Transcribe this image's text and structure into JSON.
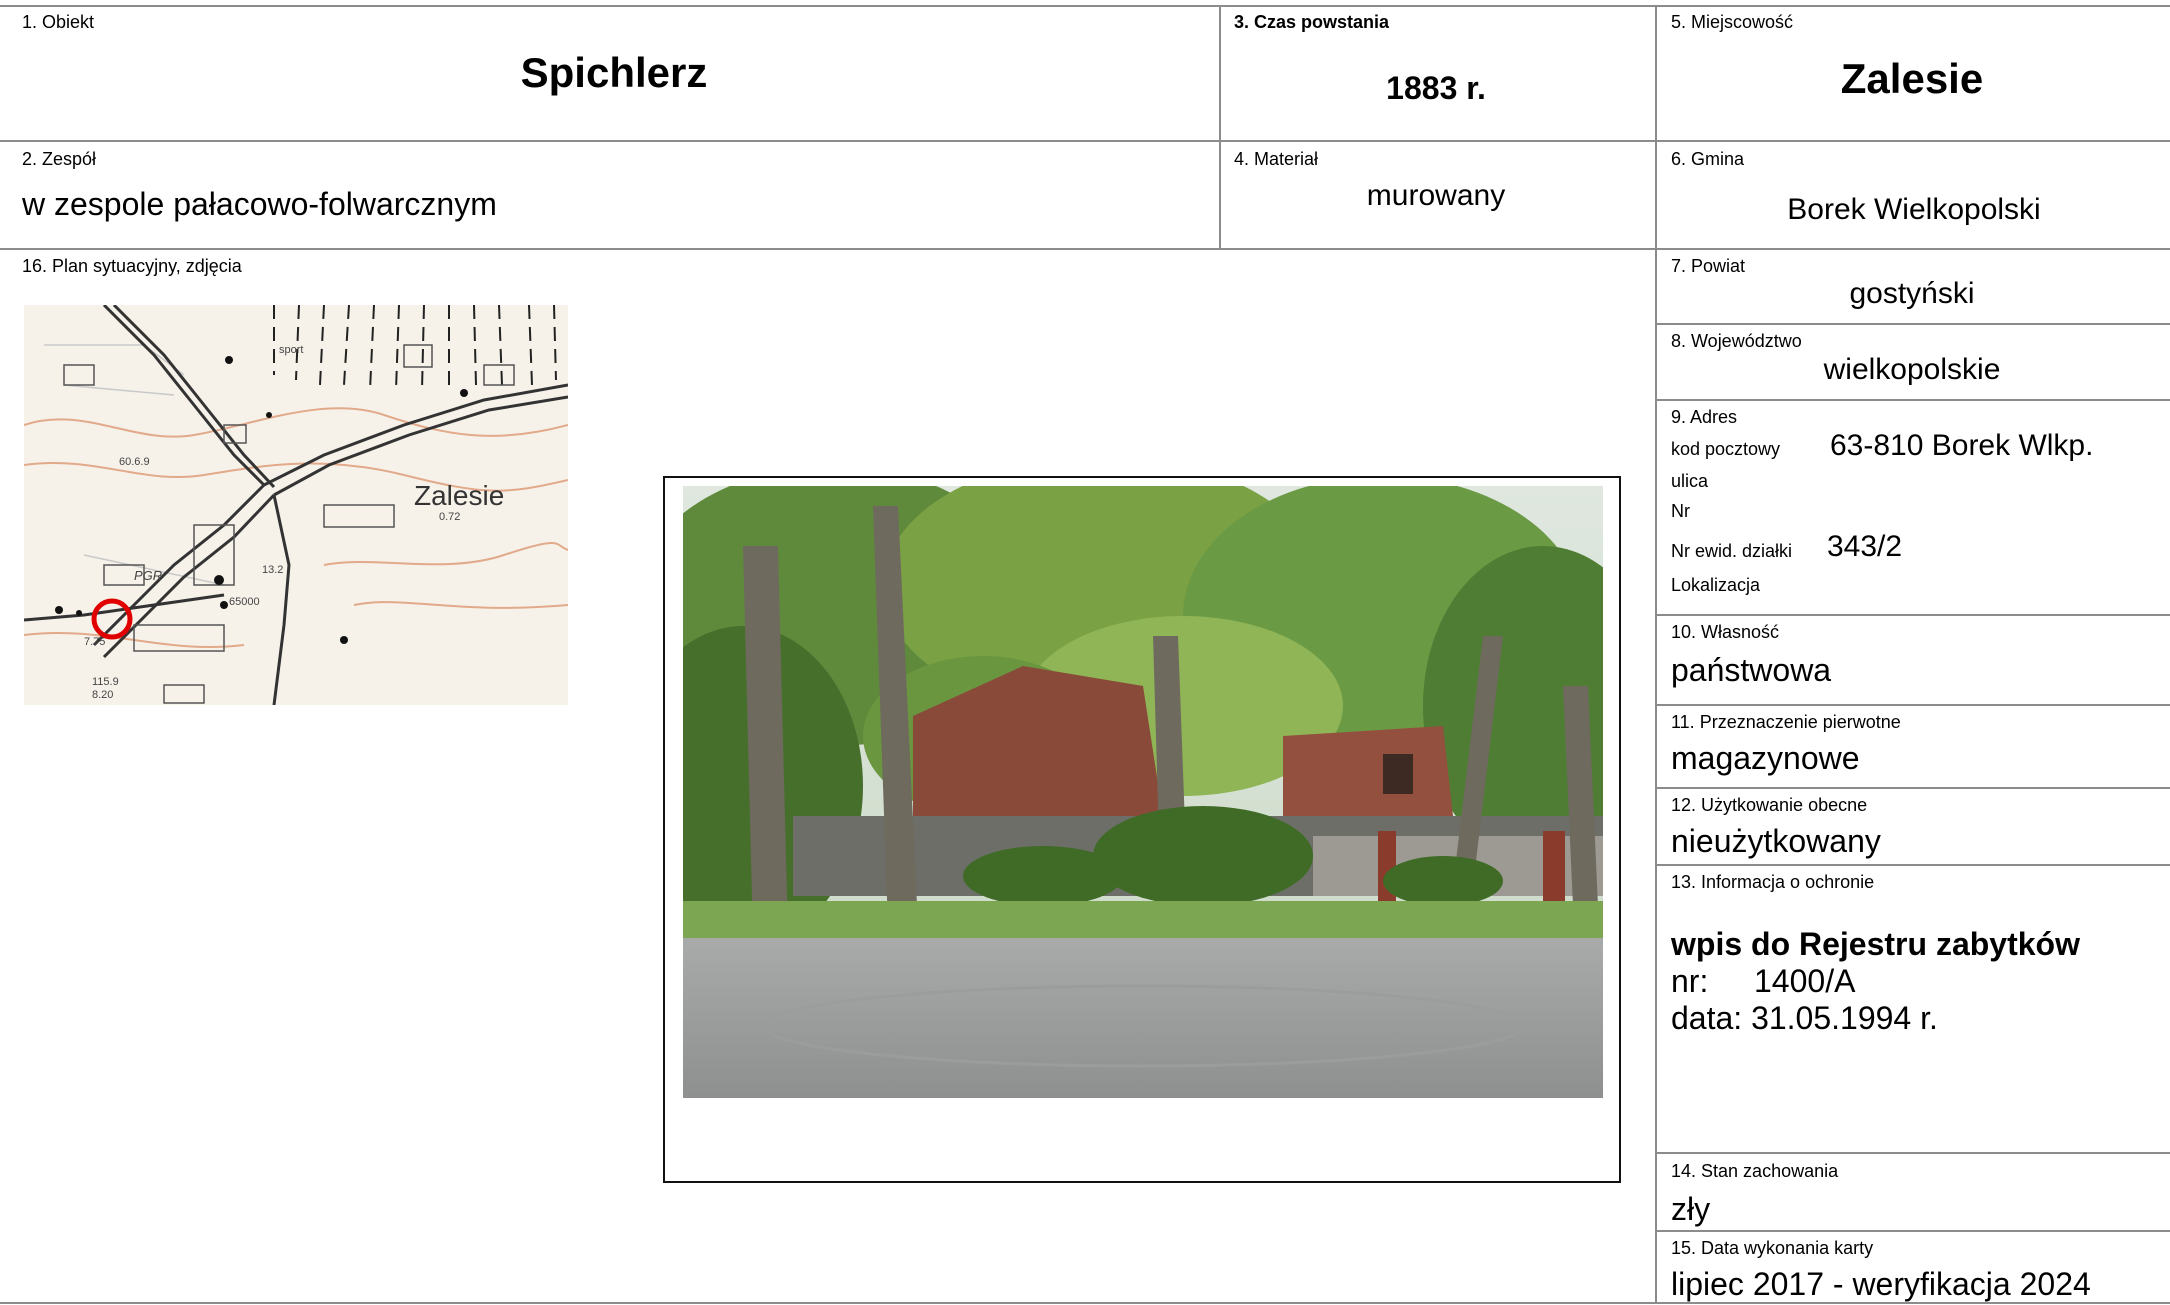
{
  "obiekt": {
    "label": "1. Obiekt",
    "value": "Spichlerz"
  },
  "zespol": {
    "label": "2. Zespół",
    "value": "w zespole pałacowo-folwarcznym"
  },
  "czas": {
    "label": "3. Czas powstania",
    "value": "1883 r."
  },
  "material": {
    "label": "4. Materiał",
    "value": "murowany"
  },
  "miejscowosc": {
    "label": "5. Miejscowość",
    "value": "Zalesie"
  },
  "gmina": {
    "label": "6. Gmina",
    "value": "Borek Wielkopolski"
  },
  "powiat": {
    "label": "7. Powiat",
    "value": "gostyński"
  },
  "wojewodztwo": {
    "label": "8. Województwo",
    "value": "wielkopolskie"
  },
  "adres": {
    "label": "9. Adres",
    "kod_label": "kod pocztowy",
    "kod_value": "63-810 Borek Wlkp.",
    "ulica_label": "ulica",
    "nr_label": "Nr",
    "dzialka_label": "Nr ewid. działki",
    "dzialka_value": "343/2",
    "lokalizacja_label": "Lokalizacja"
  },
  "wlasnosc": {
    "label": "10. Własność",
    "value": "państwowa"
  },
  "przeznaczenie": {
    "label": "11. Przeznaczenie pierwotne",
    "value": "magazynowe"
  },
  "uzytkowanie": {
    "label": "12. Użytkowanie obecne",
    "value": "nieużytkowany"
  },
  "ochrona": {
    "label": "13. Informacja o ochronie",
    "title": "wpis do Rejestru zabytków",
    "nr_label": "nr:",
    "nr_value": "1400/A",
    "data_line": "data: 31.05.1994 r."
  },
  "stan": {
    "label": "14. Stan zachowania",
    "value": "zły"
  },
  "data_karty": {
    "label": "15. Data wykonania karty",
    "value": "lipiec 2017 - weryfikacja 2024"
  },
  "plan": {
    "label": "16. Plan sytuacyjny, zdjęcia"
  },
  "map": {
    "place_name": "Zalesie",
    "marks": [
      "0.72",
      "PGR",
      "13.2",
      "115.9",
      "8.20",
      "60.6.9",
      "65000",
      "7.75",
      "sport"
    ]
  },
  "colors": {
    "rule": "#8c8c8c",
    "marker": "#e00000",
    "frame": "#111111"
  }
}
